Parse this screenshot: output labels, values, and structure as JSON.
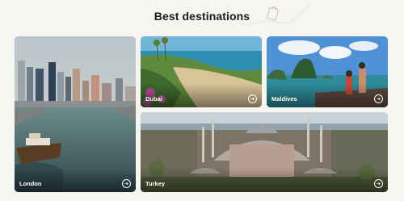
{
  "section": {
    "title": "Best destinations"
  },
  "destinations": [
    {
      "name": "London",
      "icon": "arrow-right-circle-icon"
    },
    {
      "name": "Dubai",
      "icon": "arrow-right-circle-icon"
    },
    {
      "name": "Maldives",
      "icon": "arrow-right-circle-icon"
    },
    {
      "name": "Turkey",
      "icon": "arrow-right-circle-icon"
    }
  ],
  "colors": {
    "background": "#f7f5f1",
    "title": "#1d1d1f",
    "label": "#ffffff"
  }
}
